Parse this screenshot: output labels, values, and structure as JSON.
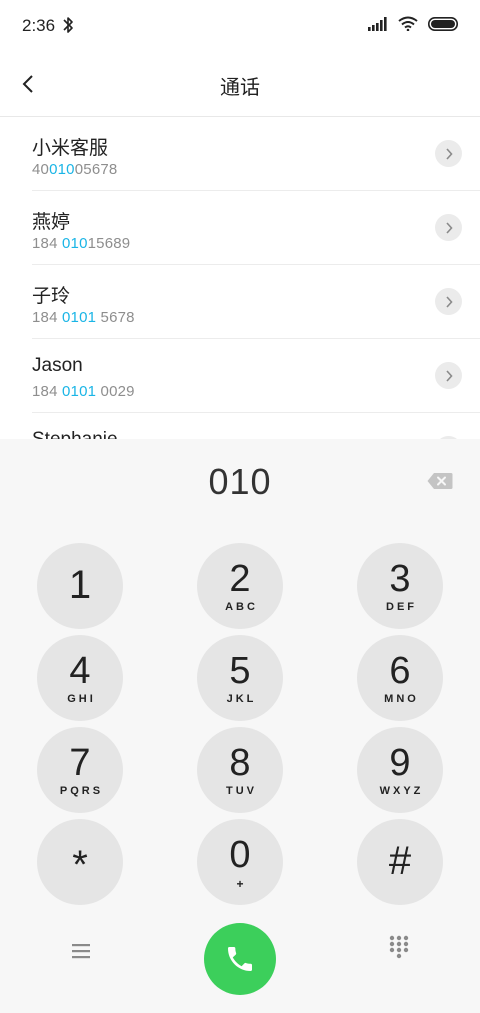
{
  "status": {
    "time": "2:36"
  },
  "header": {
    "title": "通话"
  },
  "contacts": [
    {
      "name": "小米客服",
      "number_pre": "40",
      "number_match": "010",
      "number_post": "05678"
    },
    {
      "name": "燕婷",
      "number_pre": "184 ",
      "number_match": "010",
      "number_post": "15689"
    },
    {
      "name": "子玲",
      "number_pre": "184 ",
      "number_match": "0101",
      "number_post": " 5678"
    },
    {
      "name": "Jason",
      "number_pre": "184 ",
      "number_match": "0101",
      "number_post": " 0029"
    },
    {
      "name": "Stephanie",
      "number_pre": "",
      "number_match": "",
      "number_post": ""
    }
  ],
  "dialpad": {
    "number": "010",
    "keys": [
      {
        "digit": "1",
        "letters": ""
      },
      {
        "digit": "2",
        "letters": "ABC"
      },
      {
        "digit": "3",
        "letters": "DEF"
      },
      {
        "digit": "4",
        "letters": "GHI"
      },
      {
        "digit": "5",
        "letters": "JKL"
      },
      {
        "digit": "6",
        "letters": "MNO"
      },
      {
        "digit": "7",
        "letters": "PQRS"
      },
      {
        "digit": "8",
        "letters": "TUV"
      },
      {
        "digit": "9",
        "letters": "WXYZ"
      },
      {
        "digit": "*",
        "letters": ""
      },
      {
        "digit": "0",
        "letters": "+"
      },
      {
        "digit": "#",
        "letters": ""
      }
    ]
  },
  "colors": {
    "highlight": "#1ab5e6",
    "call": "#3ccf5b"
  },
  "icons": {
    "back": "chevron-left-icon",
    "bluetooth": "bluetooth-icon",
    "signal": "signal-icon",
    "wifi": "wifi-icon",
    "battery": "battery-icon",
    "backspace": "backspace-icon",
    "menu": "menu-icon",
    "call": "phone-icon",
    "keypad": "keypad-icon"
  }
}
